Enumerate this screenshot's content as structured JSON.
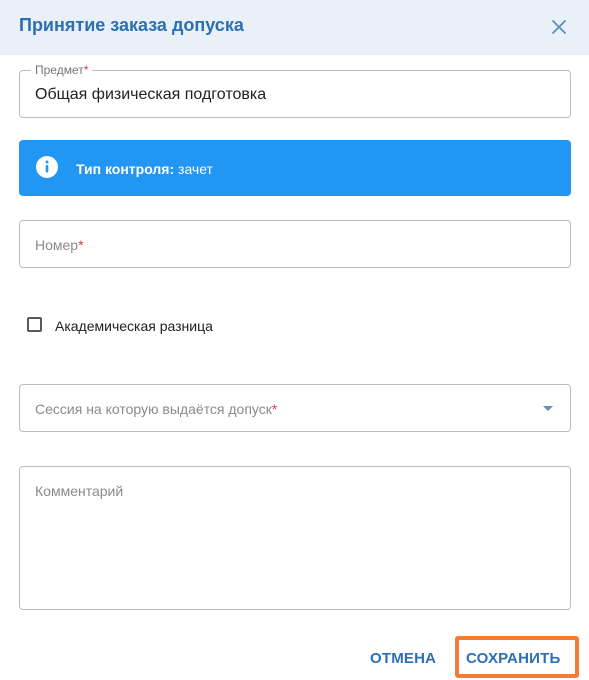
{
  "dialog": {
    "title": "Принятие заказа допуска",
    "close_icon": "close-icon"
  },
  "fields": {
    "subject": {
      "label": "Предмет",
      "required_mark": "*",
      "value": "Общая физическая подготовка"
    },
    "number": {
      "placeholder": "Номер",
      "required_mark": "*"
    },
    "session": {
      "placeholder": "Сессия на которую выдаётся допуск",
      "required_mark": "*",
      "icon": "dropdown-arrow-icon"
    },
    "comment": {
      "placeholder": "Комментарий"
    }
  },
  "alert": {
    "icon": "info-icon",
    "label": "Тип контроля:",
    "value": "зачет",
    "color": "#2196f3"
  },
  "checkbox": {
    "label": "Академическая разница",
    "checked": false
  },
  "actions": {
    "cancel_label": "ОТМЕНА",
    "save_label": "СОХРАНИТЬ"
  },
  "colors": {
    "accent": "#2c6fb3",
    "header_bg": "#e9f0f8",
    "required": "#e53935",
    "highlight": "#f47b35"
  }
}
